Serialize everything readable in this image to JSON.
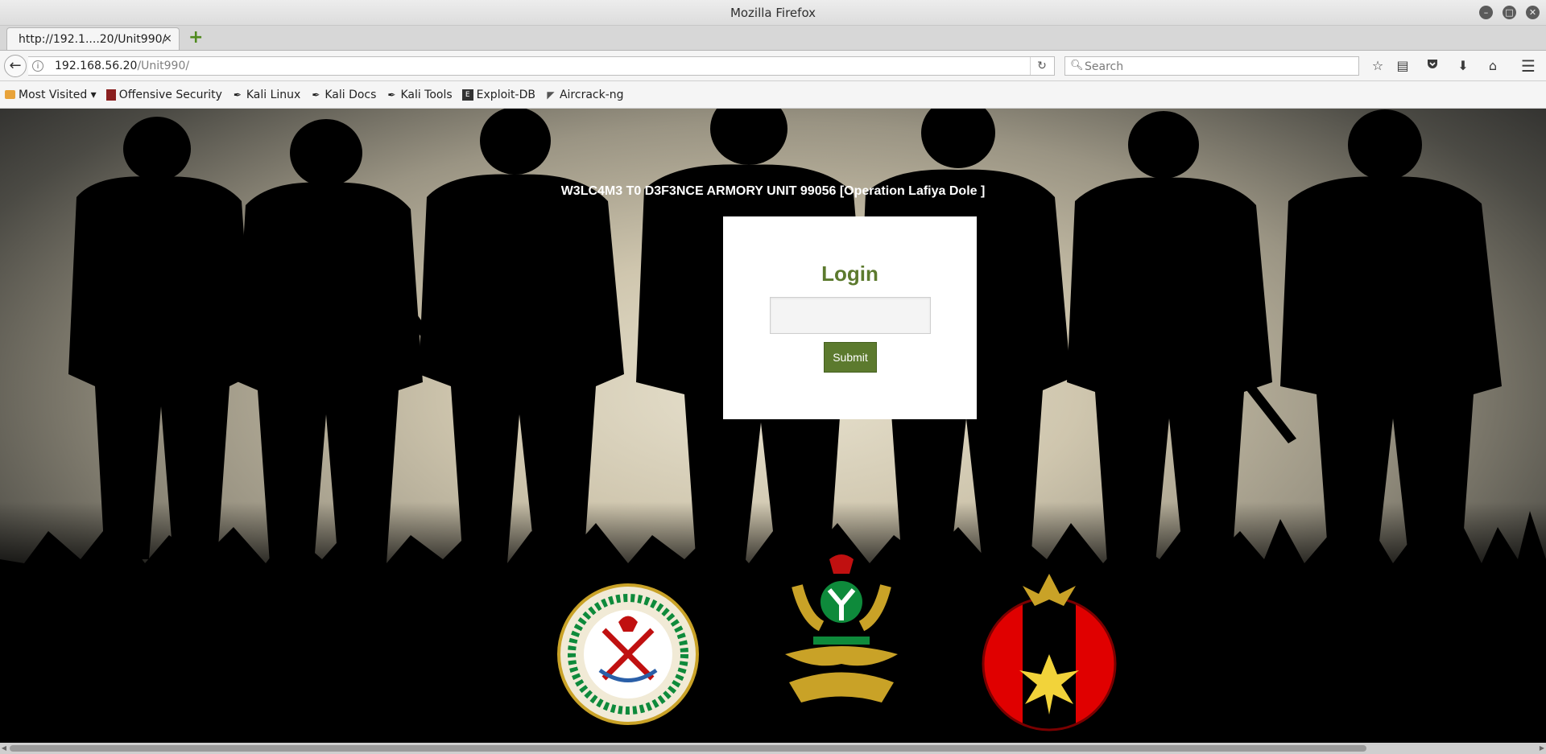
{
  "window": {
    "title": "Mozilla Firefox",
    "controls": {
      "minimize": "–",
      "maximize": "□",
      "close": "✕"
    }
  },
  "tabs": [
    {
      "label": "http://192.1....20/Unit990/",
      "close": "×",
      "active": true
    }
  ],
  "new_tab_symbol": "+",
  "navbar": {
    "url_host": "192.168.56.20",
    "url_path": "/Unit990/",
    "search_placeholder": "Search"
  },
  "bookmarks": [
    {
      "label": "Most Visited ▾",
      "icon": "folder-icon"
    },
    {
      "label": "Offensive Security",
      "icon": "offsec-icon"
    },
    {
      "label": "Kali Linux",
      "icon": "kali-dragon-icon"
    },
    {
      "label": "Kali Docs",
      "icon": "kali-dragon-icon"
    },
    {
      "label": "Kali Tools",
      "icon": "kali-dragon-icon"
    },
    {
      "label": "Exploit-DB",
      "icon": "exploitdb-icon"
    },
    {
      "label": "Aircrack-ng",
      "icon": "aircrack-icon"
    }
  ],
  "page": {
    "banner": "W3LC4M3 T0 D3F3NCE ARMORY UNIT 99056 [Operation Lafiya Dole ]",
    "login": {
      "title": "Login",
      "input_value": "",
      "submit_label": "Submit"
    }
  },
  "colors": {
    "accent_green": "#5c7a2e",
    "emblem_red": "#e00000",
    "emblem_green": "#0e8a3b",
    "emblem_gold": "#c9a227"
  }
}
